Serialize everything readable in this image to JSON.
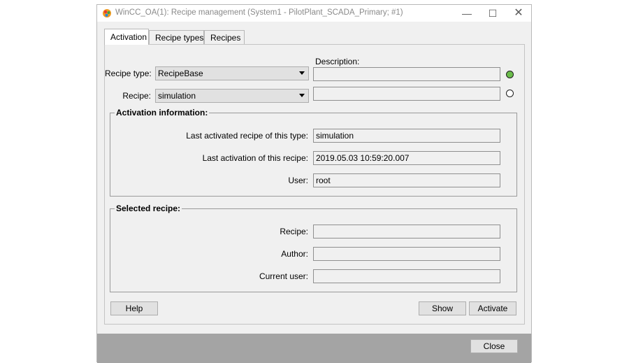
{
  "window": {
    "title": "WinCC_OA(1): Recipe management (System1 - PilotPlant_SCADA_Primary; #1)"
  },
  "tabs": [
    {
      "label": "Activation"
    },
    {
      "label": "Recipe types"
    },
    {
      "label": "Recipes"
    }
  ],
  "activation": {
    "description_label": "Description:",
    "recipe_type": {
      "label": "Recipe type:",
      "value": "RecipeBase",
      "description": ""
    },
    "recipe": {
      "label": "Recipe:",
      "value": "simulation",
      "description": ""
    }
  },
  "activation_info": {
    "title": "Activation information:",
    "last_recipe_label": "Last activated recipe of this type:",
    "last_recipe_value": "simulation",
    "last_activation_label": "Last activation of this recipe:",
    "last_activation_value": "2019.05.03 10:59:20.007",
    "user_label": "User:",
    "user_value": "root"
  },
  "selected_recipe": {
    "title": "Selected recipe:",
    "recipe_label": "Recipe:",
    "recipe_value": "",
    "author_label": "Author:",
    "author_value": "",
    "current_user_label": "Current user:",
    "current_user_value": ""
  },
  "buttons": {
    "help": "Help",
    "show": "Show",
    "activate": "Activate",
    "close": "Close"
  },
  "colors": {
    "led_on": "#6bbd4b",
    "footer": "#a4a4a4",
    "panel": "#f0f0f0"
  }
}
